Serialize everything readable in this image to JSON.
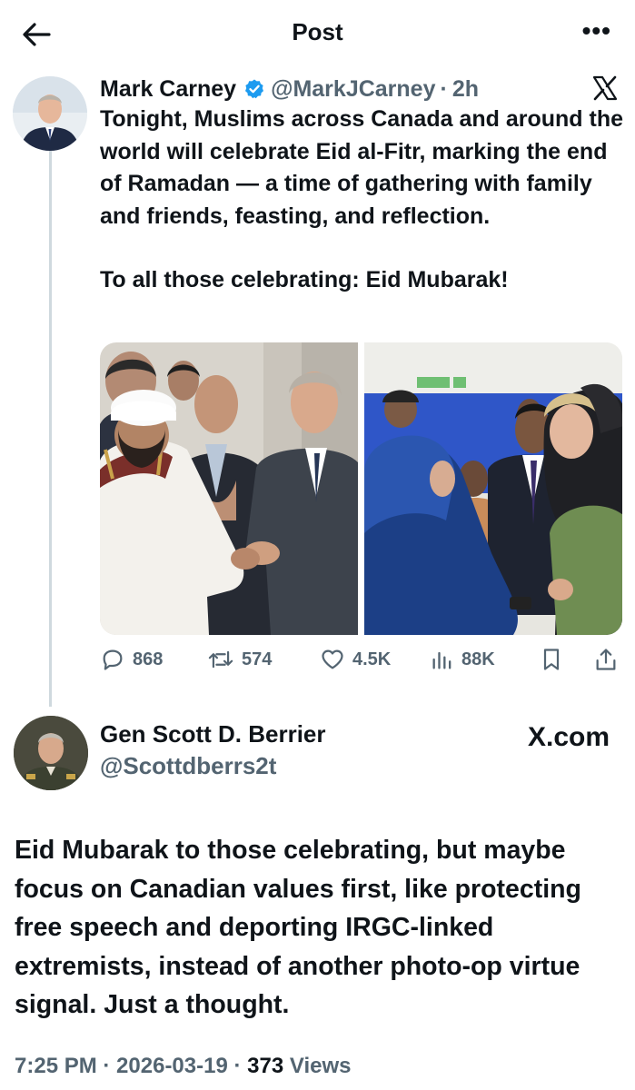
{
  "header": {
    "title": "Post",
    "back_icon": "back-arrow-icon",
    "more_icon": "more-options-icon"
  },
  "tweet": {
    "name": "Mark Carney",
    "verified": true,
    "handle": "@MarkJCarney",
    "separator": "·",
    "time": "2h",
    "paragraphs": [
      "Tonight, Muslims across Canada and around the world will celebrate Eid al-Fitr, marking the end of Ramadan — a time of gathering with family and friends, feasting, and reflection.",
      "To all those celebrating: Eid Mubarak!"
    ],
    "stats": {
      "replies": "868",
      "reposts": "574",
      "likes": "4.5K",
      "views": "88K"
    }
  },
  "reply": {
    "name": "Gen Scott D. Berrier",
    "handle": "@Scottdberrs2t",
    "source": "X.com",
    "text": "Eid Mubarak to those celebrating, but maybe focus on Canadian values first, like protecting free speech and deporting IRGC-linked extremists, instead of another photo-op virtue signal. Just a thought.",
    "footer": {
      "time": "7:25 PM",
      "sep1": "·",
      "date": "2026-03-19",
      "sep2": "·",
      "views_count": "373",
      "views_label": "Views"
    }
  },
  "colors": {
    "text": "#0f1419",
    "secondary": "#536471",
    "verified_blue": "#1d9bf0",
    "thread_line": "#cfd9de"
  }
}
